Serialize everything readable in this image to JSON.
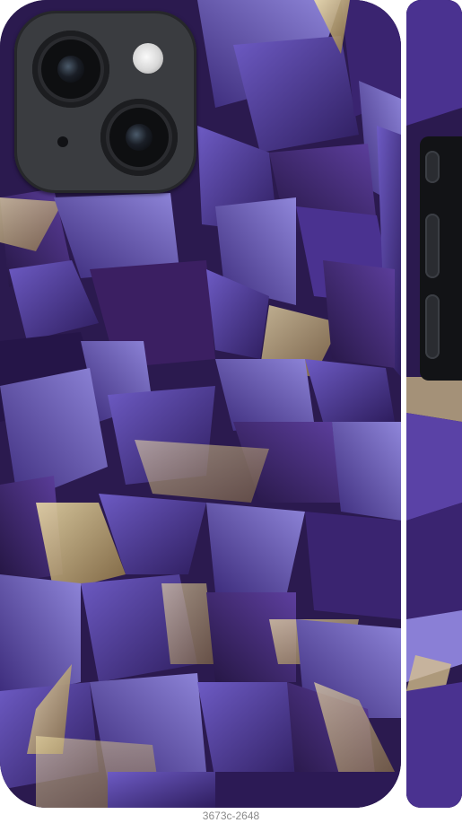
{
  "product": {
    "code": "3673c-2648",
    "print_theme": "amethyst-crystals",
    "colors": {
      "base": "#2b1a4f",
      "crystal_dark": "#3a2470",
      "crystal_mid": "#5a42a6",
      "crystal_light": "#8a7fd6",
      "gold_glint": "#d9c48a",
      "camera_frame": "#3a3c40"
    }
  },
  "icons": {
    "camera_lens": "camera-lens-icon",
    "flash": "flash-icon",
    "microphone": "microphone-icon"
  }
}
